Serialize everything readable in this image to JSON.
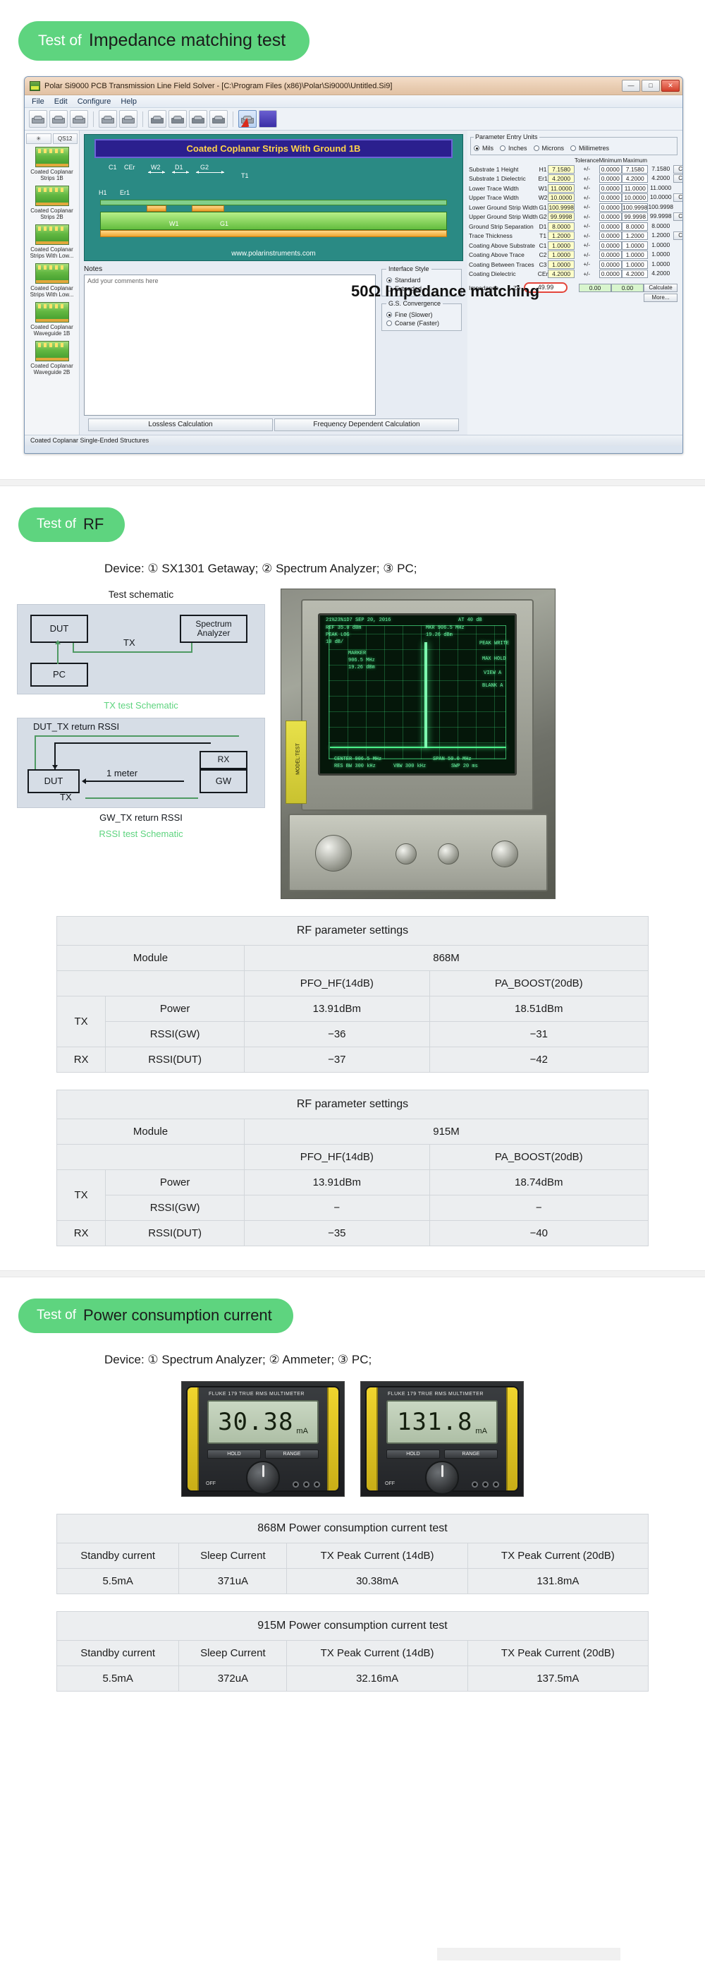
{
  "sections": {
    "impedance": {
      "pill_pre": "Test of",
      "pill_main": "Impedance matching test",
      "note": "50Ω Impedance matching"
    },
    "rf": {
      "pill_pre": "Test of",
      "pill_main": "RF",
      "device_line": "Device: ① SX1301 Getaway;   ② Spectrum Analyzer;   ③ PC;",
      "schematic_caption": "Test schematic"
    },
    "power": {
      "pill_pre": "Test of",
      "pill_main": "Power consumption current",
      "device_line": "Device: ① Spectrum Analyzer;   ② Ammeter;   ③ PC;"
    }
  },
  "app": {
    "title": "Polar Si9000 PCB Transmission Line Field Solver - [C:\\Program Files (x86)\\Polar\\Si9000\\Untitled.Si9]",
    "window_buttons": [
      "—",
      "□",
      "✕"
    ],
    "menus": [
      "File",
      "Edit",
      "Configure",
      "Help"
    ],
    "toolbar_labels": [
      "✳",
      "QS12"
    ],
    "left_items": [
      "Coated Coplanar Strips 1B",
      "Coated Coplanar Strips 2B",
      "Coated Coplanar Strips With Low...",
      "Coated Coplanar Strips With Low...",
      "Coated Coplanar Waveguide 1B",
      "Coated Coplanar Waveguide 2B"
    ],
    "diagram": {
      "title": "Coated Coplanar Strips With Ground 1B",
      "labels": [
        "C1",
        "CEr",
        "W2",
        "D1",
        "G2",
        "T1",
        "H1",
        "Er1",
        "W1",
        "G1"
      ],
      "url": "www.polarinstruments.com"
    },
    "notes": {
      "header": "Notes",
      "placeholder": "Add your comments here"
    },
    "interface_style": {
      "legend": "Interface Style",
      "options": [
        "Standard",
        "Extended"
      ],
      "selected": "Standard"
    },
    "gs_convergence": {
      "legend": "G.S. Convergence",
      "options": [
        "Fine (Slower)",
        "Coarse (Faster)"
      ],
      "selected": "Fine (Slower)"
    },
    "impedance_row": {
      "label": "Impedance",
      "code": "Zo",
      "value": "49.99",
      "min": "0.00",
      "max": "0.00",
      "calculate": "Calculate",
      "more": "More..."
    },
    "bottom_tabs": [
      "Lossless Calculation",
      "Frequency Dependent Calculation"
    ],
    "statusbar": "Coated Coplanar Single-Ended Structures",
    "param_units": {
      "legend": "Parameter Entry Units",
      "options": [
        "Mils",
        "Inches",
        "Microns",
        "Millimetres"
      ],
      "selected": "Mils"
    },
    "param_headers": [
      "",
      "",
      "",
      "Tolerance",
      "Minimum",
      "Maximum",
      ""
    ],
    "param_rows": [
      {
        "name": "Substrate 1 Height",
        "code": "H1",
        "value": "7.1580",
        "tol": "+/-",
        "min": "0.0000",
        "lo": "7.1580",
        "hi": "7.1580",
        "calc": "Calculate"
      },
      {
        "name": "Substrate 1 Dielectric",
        "code": "Er1",
        "value": "4.2000",
        "tol": "+/-",
        "min": "0.0000",
        "lo": "4.2000",
        "hi": "4.2000",
        "calc": "Calculate"
      },
      {
        "name": "Lower Trace Width",
        "code": "W1",
        "value": "11.0000",
        "tol": "+/-",
        "min": "0.0000",
        "lo": "11.0000",
        "hi": "11.0000",
        "calc": ""
      },
      {
        "name": "Upper Trace Width",
        "code": "W2",
        "value": "10.0000",
        "tol": "+/-",
        "min": "0.0000",
        "lo": "10.0000",
        "hi": "10.0000",
        "calc": "Calculate"
      },
      {
        "name": "Lower Ground Strip Width",
        "code": "G1",
        "value": "100.9998",
        "tol": "+/-",
        "min": "0.0000",
        "lo": "100.9998",
        "hi": "100.9998",
        "calc": ""
      },
      {
        "name": "Upper Ground Strip Width",
        "code": "G2",
        "value": "99.9998",
        "tol": "+/-",
        "min": "0.0000",
        "lo": "99.9998",
        "hi": "99.9998",
        "calc": "Calculate"
      },
      {
        "name": "Ground Strip Separation",
        "code": "D1",
        "value": "8.0000",
        "tol": "+/-",
        "min": "0.0000",
        "lo": "8.0000",
        "hi": "8.0000",
        "calc": ""
      },
      {
        "name": "Trace Thickness",
        "code": "T1",
        "value": "1.2000",
        "tol": "+/-",
        "min": "0.0000",
        "lo": "1.2000",
        "hi": "1.2000",
        "calc": "Calculate"
      },
      {
        "name": "Coating Above Substrate",
        "code": "C1",
        "value": "1.0000",
        "tol": "+/-",
        "min": "0.0000",
        "lo": "1.0000",
        "hi": "1.0000",
        "calc": ""
      },
      {
        "name": "Coating Above Trace",
        "code": "C2",
        "value": "1.0000",
        "tol": "+/-",
        "min": "0.0000",
        "lo": "1.0000",
        "hi": "1.0000",
        "calc": ""
      },
      {
        "name": "Coating Between Traces",
        "code": "C3",
        "value": "1.0000",
        "tol": "+/-",
        "min": "0.0000",
        "lo": "1.0000",
        "hi": "1.0000",
        "calc": ""
      },
      {
        "name": "Coating Dielectric",
        "code": "CEr",
        "value": "4.2000",
        "tol": "+/-",
        "min": "0.0000",
        "lo": "4.2000",
        "hi": "4.2000",
        "calc": ""
      }
    ]
  },
  "schematics": {
    "tx": {
      "blocks": [
        "DUT",
        "Spectrum Analyzer",
        "PC"
      ],
      "edge_label": "TX",
      "caption": "TX test Schematic"
    },
    "rssi": {
      "top_label": "DUT_TX return RSSI",
      "blocks": [
        "DUT",
        "RX",
        "GW",
        "TX"
      ],
      "distance": "1 meter",
      "bottom_label": "GW_TX return RSSI",
      "caption": "RSSI test Schematic"
    }
  },
  "scope": {
    "header_left": "21%23%1D7 SEP 20, 2016",
    "lines": [
      "REF 35.0 dBm",
      "PEAK LOG",
      "10 dB/",
      "MKR 906.5 MHz",
      "19.26 dBm",
      "PEAK WRITE",
      "MARKER",
      "906.5 MHz",
      "19.26 dBm",
      "MAX HOLD",
      "VIEW A",
      "BLANK A",
      "CENTER 906.5 MHz",
      "SPAN 50.0 MHz",
      "RES BW 300 kHz",
      "VBW 300 kHz",
      "SWP 20 ms",
      "AT 40 dB"
    ],
    "model_tag": "MODEL:TEST"
  },
  "meters": [
    {
      "value": "30.38",
      "unit": "mA",
      "brand": "FLUKE 179 TRUE RMS MULTIMETER",
      "buttons": [
        "HOLD",
        "RANGE"
      ],
      "off": "OFF"
    },
    {
      "value": "131.8",
      "unit": "mA",
      "brand": "FLUKE 179 TRUE RMS MULTIMETER",
      "buttons": [
        "HOLD",
        "RANGE"
      ],
      "off": "OFF"
    }
  ],
  "rf_tables": [
    {
      "title": "RF parameter settings",
      "module_label": "Module",
      "band": "868M",
      "col_heads": [
        "PFO_HF(14dB)",
        "PA_BOOST(20dB)"
      ],
      "rows": [
        {
          "group": "TX",
          "label": "Power",
          "v1": "13.91dBm",
          "v2": "18.51dBm"
        },
        {
          "group": "",
          "label": "RSSI(GW)",
          "v1": "−36",
          "v2": "−31"
        },
        {
          "group": "RX",
          "label": "RSSI(DUT)",
          "v1": "−37",
          "v2": "−42"
        }
      ]
    },
    {
      "title": "RF parameter settings",
      "module_label": "Module",
      "band": "915M",
      "col_heads": [
        "PFO_HF(14dB)",
        "PA_BOOST(20dB)"
      ],
      "rows": [
        {
          "group": "TX",
          "label": "Power",
          "v1": "13.91dBm",
          "v2": "18.74dBm"
        },
        {
          "group": "",
          "label": "RSSI(GW)",
          "v1": "−",
          "v2": "−"
        },
        {
          "group": "RX",
          "label": "RSSI(DUT)",
          "v1": "−35",
          "v2": "−40"
        }
      ]
    }
  ],
  "power_tables": [
    {
      "title": "868M Power consumption current test",
      "heads": [
        "Standby current",
        "Sleep Current",
        "TX Peak Current (14dB)",
        "TX Peak Current (20dB)"
      ],
      "values": [
        "5.5mA",
        "371uA",
        "30.38mA",
        "131.8mA"
      ]
    },
    {
      "title": "915M Power consumption current test",
      "heads": [
        "Standby current",
        "Sleep Current",
        "TX Peak Current (14dB)",
        "TX Peak Current (20dB)"
      ],
      "values": [
        "5.5mA",
        "372uA",
        "32.16mA",
        "137.5mA"
      ]
    }
  ]
}
